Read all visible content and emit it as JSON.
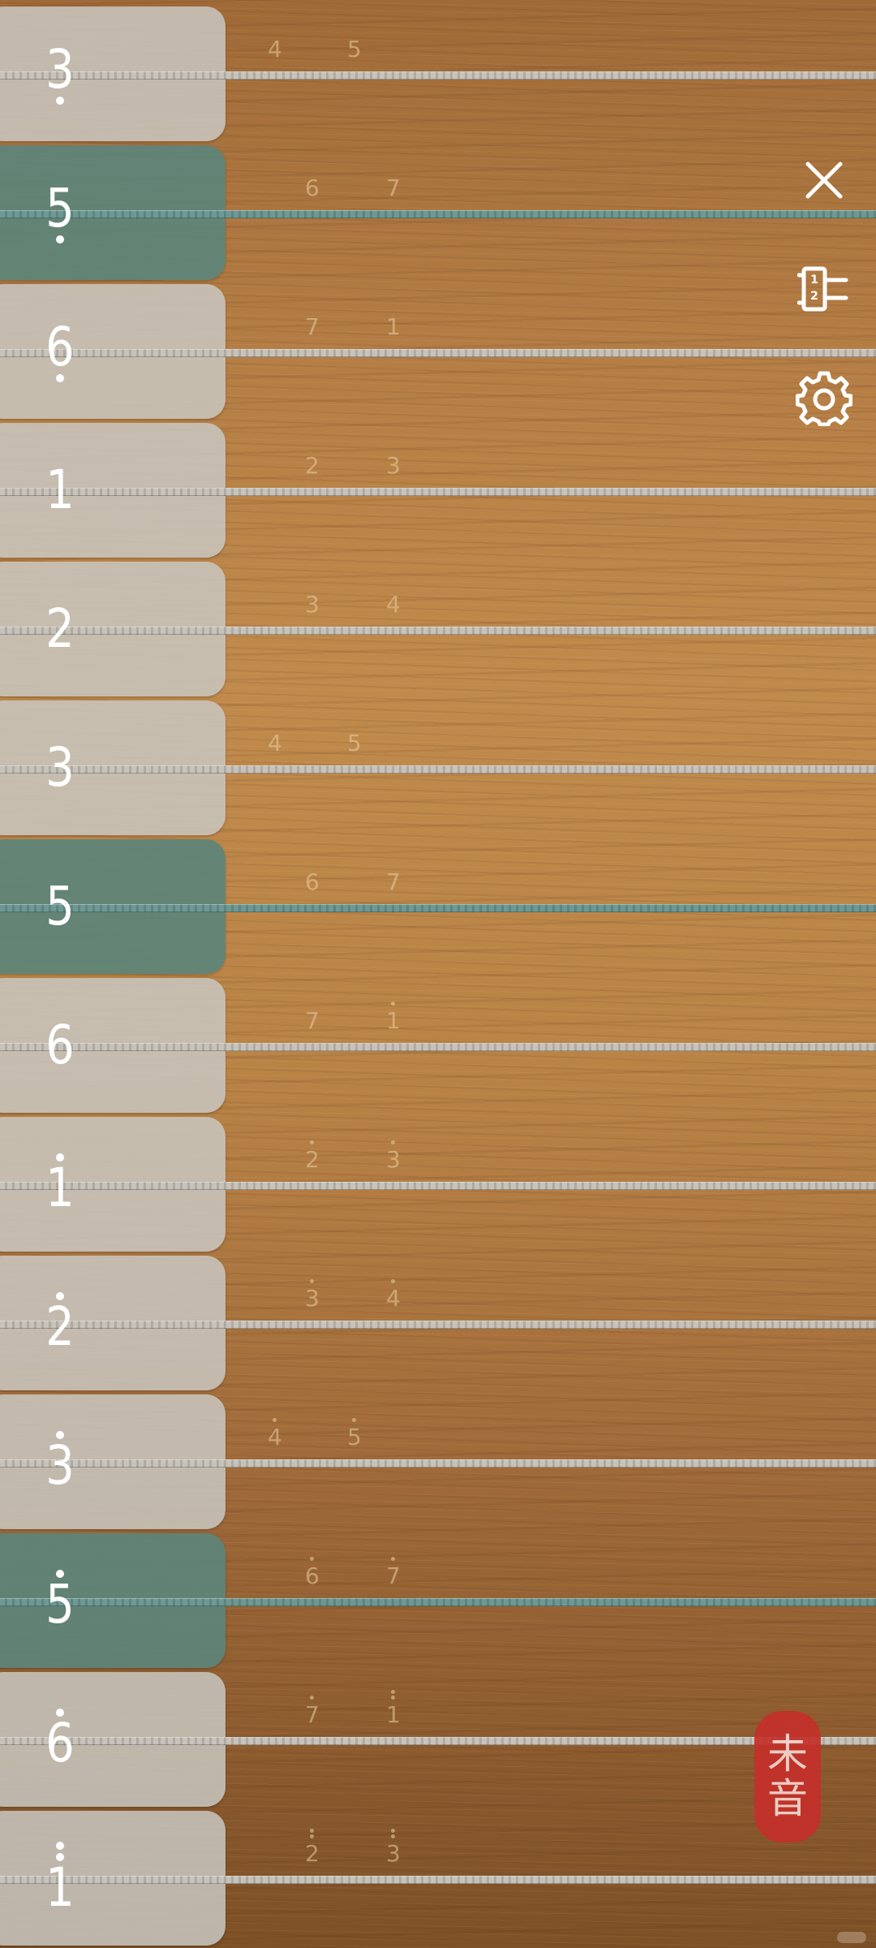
{
  "strings": [
    {
      "note": "3",
      "dots_below": 1,
      "dots_above": 0,
      "accent": false,
      "hints": [
        {
          "text": "4",
          "dots": 0
        },
        {
          "text": "5",
          "dots": 0
        }
      ]
    },
    {
      "note": "5",
      "dots_below": 1,
      "dots_above": 0,
      "accent": true,
      "hints": [
        {
          "text": "6",
          "dots": 0
        },
        {
          "text": "7",
          "dots": 0
        }
      ]
    },
    {
      "note": "6",
      "dots_below": 1,
      "dots_above": 0,
      "accent": false,
      "hints": [
        {
          "text": "7",
          "dots": 0
        },
        {
          "text": "1",
          "dots": 0
        }
      ]
    },
    {
      "note": "1",
      "dots_below": 0,
      "dots_above": 0,
      "accent": false,
      "hints": [
        {
          "text": "2",
          "dots": 0
        },
        {
          "text": "3",
          "dots": 0
        }
      ]
    },
    {
      "note": "2",
      "dots_below": 0,
      "dots_above": 0,
      "accent": false,
      "hints": [
        {
          "text": "3",
          "dots": 0
        },
        {
          "text": "4",
          "dots": 0
        }
      ]
    },
    {
      "note": "3",
      "dots_below": 0,
      "dots_above": 0,
      "accent": false,
      "hints": [
        {
          "text": "4",
          "dots": 0
        },
        {
          "text": "5",
          "dots": 0
        }
      ]
    },
    {
      "note": "5",
      "dots_below": 0,
      "dots_above": 0,
      "accent": true,
      "hints": [
        {
          "text": "6",
          "dots": 0
        },
        {
          "text": "7",
          "dots": 0
        }
      ]
    },
    {
      "note": "6",
      "dots_below": 0,
      "dots_above": 0,
      "accent": false,
      "hints": [
        {
          "text": "7",
          "dots": 0
        },
        {
          "text": "1",
          "dots": 1
        }
      ]
    },
    {
      "note": "1",
      "dots_below": 0,
      "dots_above": 1,
      "accent": false,
      "hints": [
        {
          "text": "2",
          "dots": 1
        },
        {
          "text": "3",
          "dots": 1
        }
      ]
    },
    {
      "note": "2",
      "dots_below": 0,
      "dots_above": 1,
      "accent": false,
      "hints": [
        {
          "text": "3",
          "dots": 1
        },
        {
          "text": "4",
          "dots": 1
        }
      ]
    },
    {
      "note": "3",
      "dots_below": 0,
      "dots_above": 1,
      "accent": false,
      "hints": [
        {
          "text": "4",
          "dots": 1
        },
        {
          "text": "5",
          "dots": 1
        }
      ]
    },
    {
      "note": "5",
      "dots_below": 0,
      "dots_above": 1,
      "accent": true,
      "hints": [
        {
          "text": "6",
          "dots": 1
        },
        {
          "text": "7",
          "dots": 1
        }
      ]
    },
    {
      "note": "6",
      "dots_below": 0,
      "dots_above": 1,
      "accent": false,
      "hints": [
        {
          "text": "7",
          "dots": 1
        },
        {
          "text": "1",
          "dots": 2
        }
      ]
    },
    {
      "note": "1",
      "dots_below": 0,
      "dots_above": 2,
      "accent": false,
      "hints": [
        {
          "text": "2",
          "dots": 2
        },
        {
          "text": "3",
          "dots": 2
        }
      ]
    }
  ],
  "toolbar": {
    "close_icon": "close-icon",
    "notation_icon": "numbered-notation-icon",
    "notation_badge": "1\n2",
    "settings_icon": "gear-icon"
  },
  "seal": {
    "char1": "未",
    "char2": "音"
  },
  "colors": {
    "accent_string": "#6e9893",
    "accent_key": "#5c847a",
    "seal_red": "#c5302a"
  }
}
